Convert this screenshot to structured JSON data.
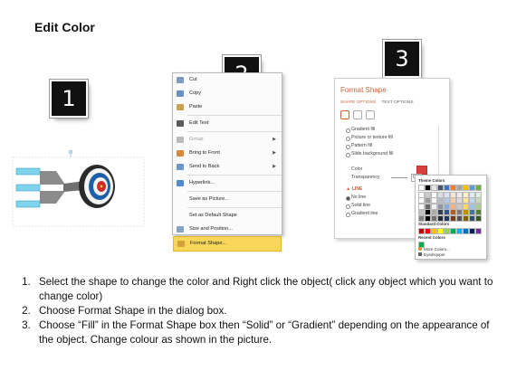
{
  "title": "Edit Color",
  "steps": [
    {
      "number": "1"
    },
    {
      "number": "2"
    },
    {
      "number": "3"
    }
  ],
  "context_menu": {
    "items": [
      {
        "label": "Cut",
        "disabled": false,
        "submenu": false,
        "icon": "scissors-icon"
      },
      {
        "label": "Copy",
        "disabled": false,
        "submenu": false,
        "icon": "copy-icon"
      },
      {
        "label": "Paste",
        "disabled": false,
        "submenu": false,
        "icon": "paste-icon"
      },
      {
        "label": "Edit Text",
        "disabled": false,
        "submenu": false,
        "icon": "edit-text-icon"
      },
      {
        "label": "Group",
        "disabled": true,
        "submenu": true,
        "icon": "group-icon"
      },
      {
        "label": "Bring to Front",
        "disabled": false,
        "submenu": true,
        "icon": "bring-front-icon"
      },
      {
        "label": "Send to Back",
        "disabled": false,
        "submenu": true,
        "icon": "send-back-icon"
      },
      {
        "label": "Hyperlink...",
        "disabled": false,
        "submenu": false,
        "icon": "hyperlink-icon"
      },
      {
        "label": "Save as Picture...",
        "disabled": false,
        "submenu": false,
        "icon": ""
      },
      {
        "label": "Set as Default Shape",
        "disabled": false,
        "submenu": false,
        "icon": ""
      },
      {
        "label": "Size and Position...",
        "disabled": false,
        "submenu": false,
        "icon": "size-position-icon"
      },
      {
        "label": "Format Shape...",
        "disabled": false,
        "submenu": false,
        "icon": "format-shape-icon",
        "highlighted": true
      }
    ]
  },
  "format_pane": {
    "title": "Format Shape",
    "tabs": [
      "SHAPE OPTIONS",
      "TEXT OPTIONS"
    ],
    "fill_options": [
      "Gradient fill",
      "Picture or texture fill",
      "Pattern fill",
      "Slide background fill"
    ],
    "color_label": "Color",
    "transparency_label": "Transparency",
    "transparency_value": "0%",
    "line_header": "LINE",
    "line_options": [
      "No line",
      "Solid line",
      "Gradient line"
    ]
  },
  "color_dropdown": {
    "theme_label": "Theme Colors",
    "standard_label": "Standard Colors",
    "recent_label": "Recent Colors",
    "more_colors": "More Colors...",
    "eyedropper": "Eyedropper",
    "theme_colors": [
      "#ffffff",
      "#000000",
      "#e7e6e6",
      "#44546a",
      "#4472c4",
      "#ed7d31",
      "#a5a5a5",
      "#ffc000",
      "#5b9bd5",
      "#70ad47"
    ],
    "standard_colors": [
      "#c00000",
      "#ff0000",
      "#ffc000",
      "#ffff00",
      "#92d050",
      "#00b050",
      "#00b0f0",
      "#0070c0",
      "#002060",
      "#7030a0"
    ],
    "recent_colors": [
      "#00b050"
    ]
  },
  "instructions": [
    "Select the shape to change the color and Right click the object( click any object which you want to change color)",
    "Choose Format Shape in the dialog box.",
    "Choose “Fill” in the Format Shape box then “Solid” or “Gradient” depending on the appearance of the object. Change colour as shown in the picture."
  ]
}
